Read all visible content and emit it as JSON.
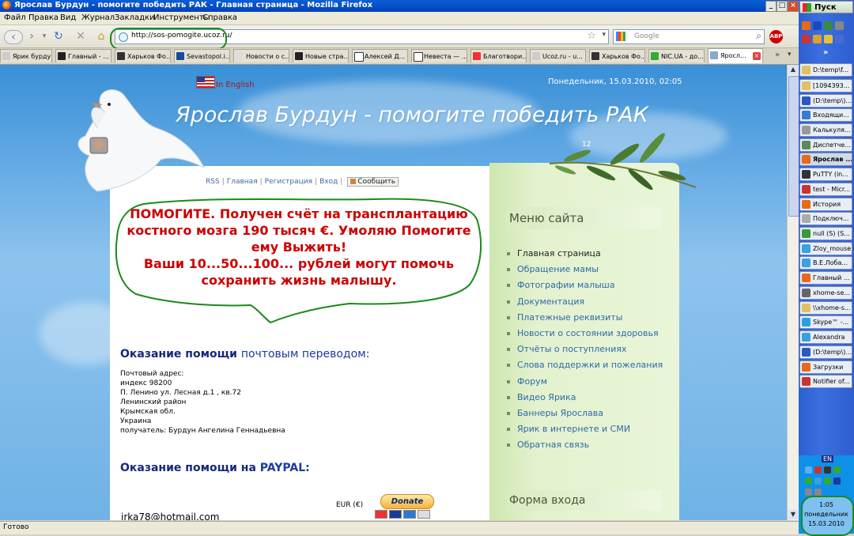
{
  "window": {
    "title": "Ярослав Бурдун - помогите победить РАК - Главная страница - Mozilla Firefox"
  },
  "menu": [
    "Файл",
    "Правка",
    "Вид",
    "Журнал",
    "Закладки",
    "Инструменты",
    "Справка"
  ],
  "nav": {
    "url": "http://sos-pomogite.ucoz.ru/",
    "search_placeholder": "Google",
    "abp": "ABP"
  },
  "tabs": [
    "Ярик бурду...",
    "Главный - ...",
    "Харьков Фо...",
    "Sevastopol.i...",
    "Новости о с...",
    "Новые стра...",
    "Алексей Д...",
    "Невеста — ...",
    "Благотвори...",
    "Ucoz.ru - u...",
    "Харьков Фо...",
    "NIC.UA - до...",
    "Яросл..."
  ],
  "page": {
    "lang_link": "In English",
    "date": "Понедельник, 15.03.2010, 02:05",
    "site_title": "Ярослав Бурдун - помогите победить РАК",
    "corner_number": "12",
    "topnav": {
      "rss": "RSS",
      "home": "Главная",
      "register": "Регистрация",
      "login": "Вход",
      "message": "Сообщить"
    },
    "appeal": {
      "line1": "ПОМОГИТЕ. Получен счёт на трансплантацию",
      "line2": "костного мозга 190 тысяч €. Умоляю Помогите",
      "line3": "ему Выжить!",
      "line4": "Ваши 10...50...100... рублей могут помочь",
      "line5": "сохранить жизнь малышу."
    },
    "postal": {
      "heading_bold": "Оказание помощи",
      "heading_rest": "почтовым переводом:",
      "lines": [
        "Почтовый адрес:",
        "индекс 98200",
        "П. Ленино ул. Лесная д.1 , кв.72",
        "Ленинский район",
        "Крымская обл.",
        "Украина",
        "получатель: Бурдун Ангелина Геннадьевна"
      ]
    },
    "paypal": {
      "heading_bold": "Оказание помощи на",
      "heading_rest": "PAYPAL:",
      "currency": "EUR (€)",
      "donate_label": "Donate",
      "email": "irka78@hotmail.com"
    },
    "sidebar": {
      "menu_title": "Меню сайта",
      "items": [
        "Главная страница",
        "Обращение мамы",
        "Фотографии малыша",
        "Документация",
        "Платежные реквизиты",
        "Новости о состоянии здоровья",
        "Отчёты о поступлениях",
        "Слова поддержки и пожелания",
        "Форум",
        "Видео Ярика",
        "Баннеры Ярослава",
        "Ярик в интернете и СМИ",
        "Обратная связь"
      ],
      "login_title": "Форма входа"
    }
  },
  "status": "Готово",
  "taskbar": {
    "start": "Пуск",
    "more": "»",
    "buttons": [
      "D:\\temp\\f...",
      "[1094393...",
      "(D:\\temp\\)...",
      "Входящи...",
      "Калькуля...",
      "Диспетче...",
      "Ярослав ...",
      "PuTTY (in...",
      "test - Micr...",
      "История",
      "Подключ...",
      "null (S) (S...",
      "Zloy_mouse",
      "В.Е.Лоба...",
      "Главный ...",
      "xhome-se...",
      "\\\\xhome-s...",
      "Skype™ -...",
      "Alexandra",
      "(D:\\temp\\)...",
      "Загрузки",
      "Notifier of..."
    ],
    "lang": "EN",
    "clock_time": "1:05",
    "clock_day": "понедельник",
    "clock_date": "15.03.2010"
  },
  "colors": {
    "appeal_red": "#cc0000",
    "heading_navy": "#14287c",
    "link_blue": "#2b6aa8",
    "marker_green": "#1a8a1a"
  }
}
